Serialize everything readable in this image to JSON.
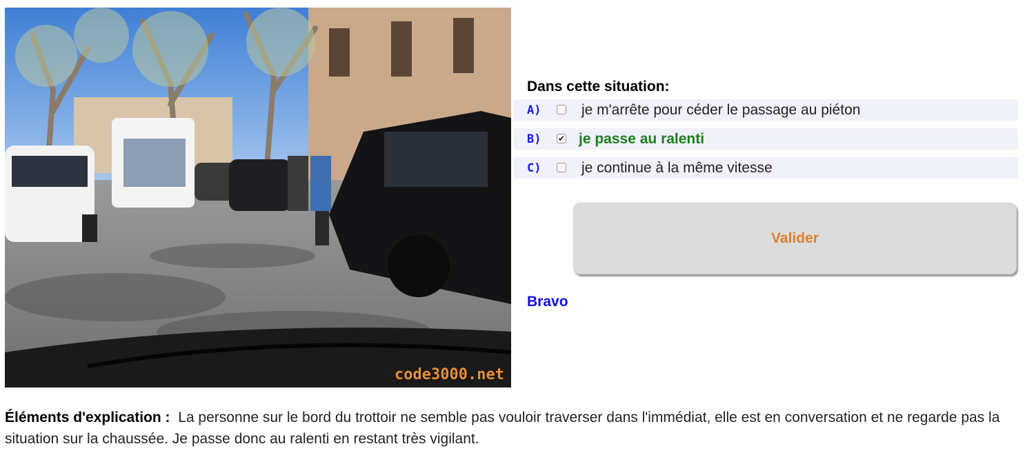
{
  "image": {
    "description_icon": "street-scene-photo",
    "watermark": "code3000.net"
  },
  "question": "Dans cette situation:",
  "answers": [
    {
      "letter": "A)",
      "text": "je m'arrête pour céder le passage au piéton",
      "checked": false,
      "correct": false
    },
    {
      "letter": "B)",
      "text": "je passe au ralenti",
      "checked": true,
      "correct": true
    },
    {
      "letter": "C)",
      "text": "je continue à la même vitesse",
      "checked": false,
      "correct": false
    }
  ],
  "submit_label": "Valider",
  "feedback": "Bravo",
  "explanation": {
    "label": "Éléments d'explication :",
    "text": "La personne sur le bord du trottoir ne semble pas vouloir traverser dans l'immédiat, elle est en conversation et ne regarde pas la situation sur la chaussée. Je passe donc au ralenti en restant très vigilant."
  },
  "colors": {
    "answer_letter": "#1a1adb",
    "correct_answer": "#1e7d1e",
    "button_text": "#d9822b",
    "feedback": "#1010e0",
    "answer_row_bg": "#f1f1f9"
  }
}
